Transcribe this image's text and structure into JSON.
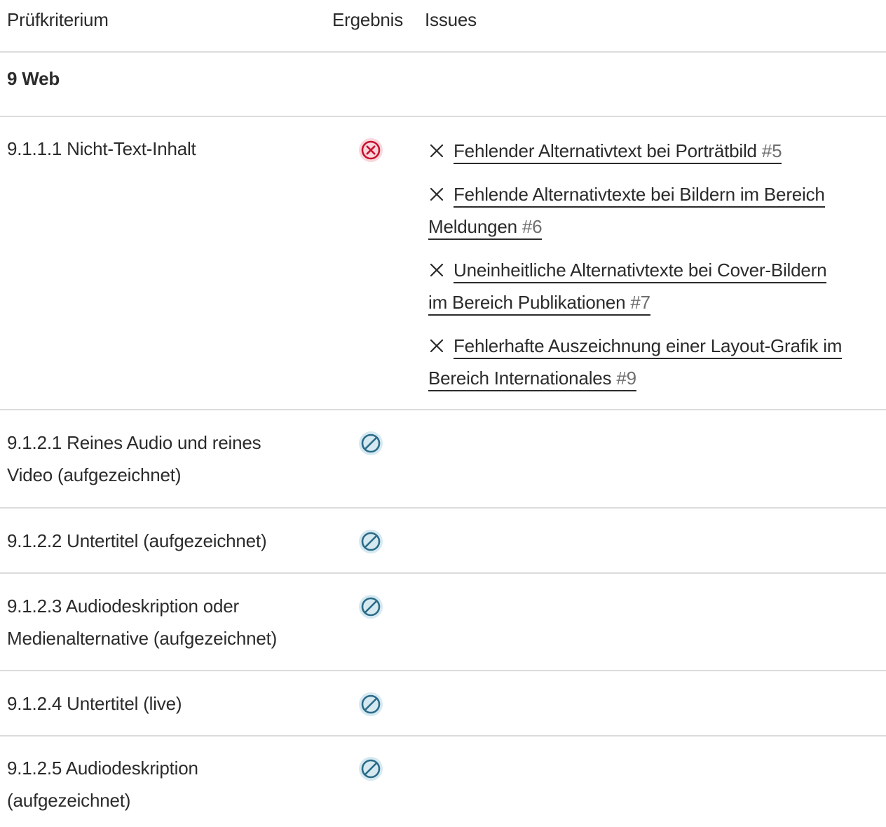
{
  "header": {
    "criterion": "Prüfkriterium",
    "result": "Ergebnis",
    "issues": "Issues"
  },
  "section": {
    "title": "9 Web"
  },
  "rows": [
    {
      "criterion_line1": "9.1.1.1 Nicht-Text-Inhalt",
      "criterion_line2": "",
      "result": "failed",
      "issues": [
        {
          "line1": "Fehlender Alternativtext bei Porträtbild",
          "line2": "",
          "number": "#5"
        },
        {
          "line1": "Fehlende Alternativtexte bei Bildern im Bereich",
          "line2": "Meldungen",
          "number": "#6"
        },
        {
          "line1": "Uneinheitliche Alternativtexte bei Cover-Bildern",
          "line2": "im Bereich Publikationen",
          "number": "#7"
        },
        {
          "line1": "Fehlerhafte Auszeichnung einer Layout-Grafik im",
          "line2": "Bereich Internationales",
          "number": "#9"
        }
      ]
    },
    {
      "criterion_line1": "9.1.2.1 Reines Audio und reines",
      "criterion_line2": "Video (aufgezeichnet)",
      "result": "not-applicable"
    },
    {
      "criterion_line1": "9.1.2.2 Untertitel (aufgezeichnet)",
      "criterion_line2": "",
      "result": "not-applicable"
    },
    {
      "criterion_line1": "9.1.2.3 Audiodeskription oder",
      "criterion_line2": "Medienalternative (aufgezeichnet)",
      "result": "not-applicable"
    },
    {
      "criterion_line1": "9.1.2.4 Untertitel (live)",
      "criterion_line2": "",
      "result": "not-applicable"
    },
    {
      "criterion_line1": "9.1.2.5 Audiodeskription",
      "criterion_line2": "(aufgezeichnet)",
      "result": "not-applicable"
    }
  ],
  "colors": {
    "failed": "#c8102e",
    "failed_bg": "#f8d7dc",
    "not_applicable": "#2a6b88",
    "not_applicable_bg": "#d6e9f1",
    "divider": "#dcdcdc",
    "issue_number": "#6f6f6f"
  },
  "icons": {
    "failed": "x-circle-icon",
    "not_applicable": "slash-circle-icon",
    "issue_marker": "x-icon"
  }
}
